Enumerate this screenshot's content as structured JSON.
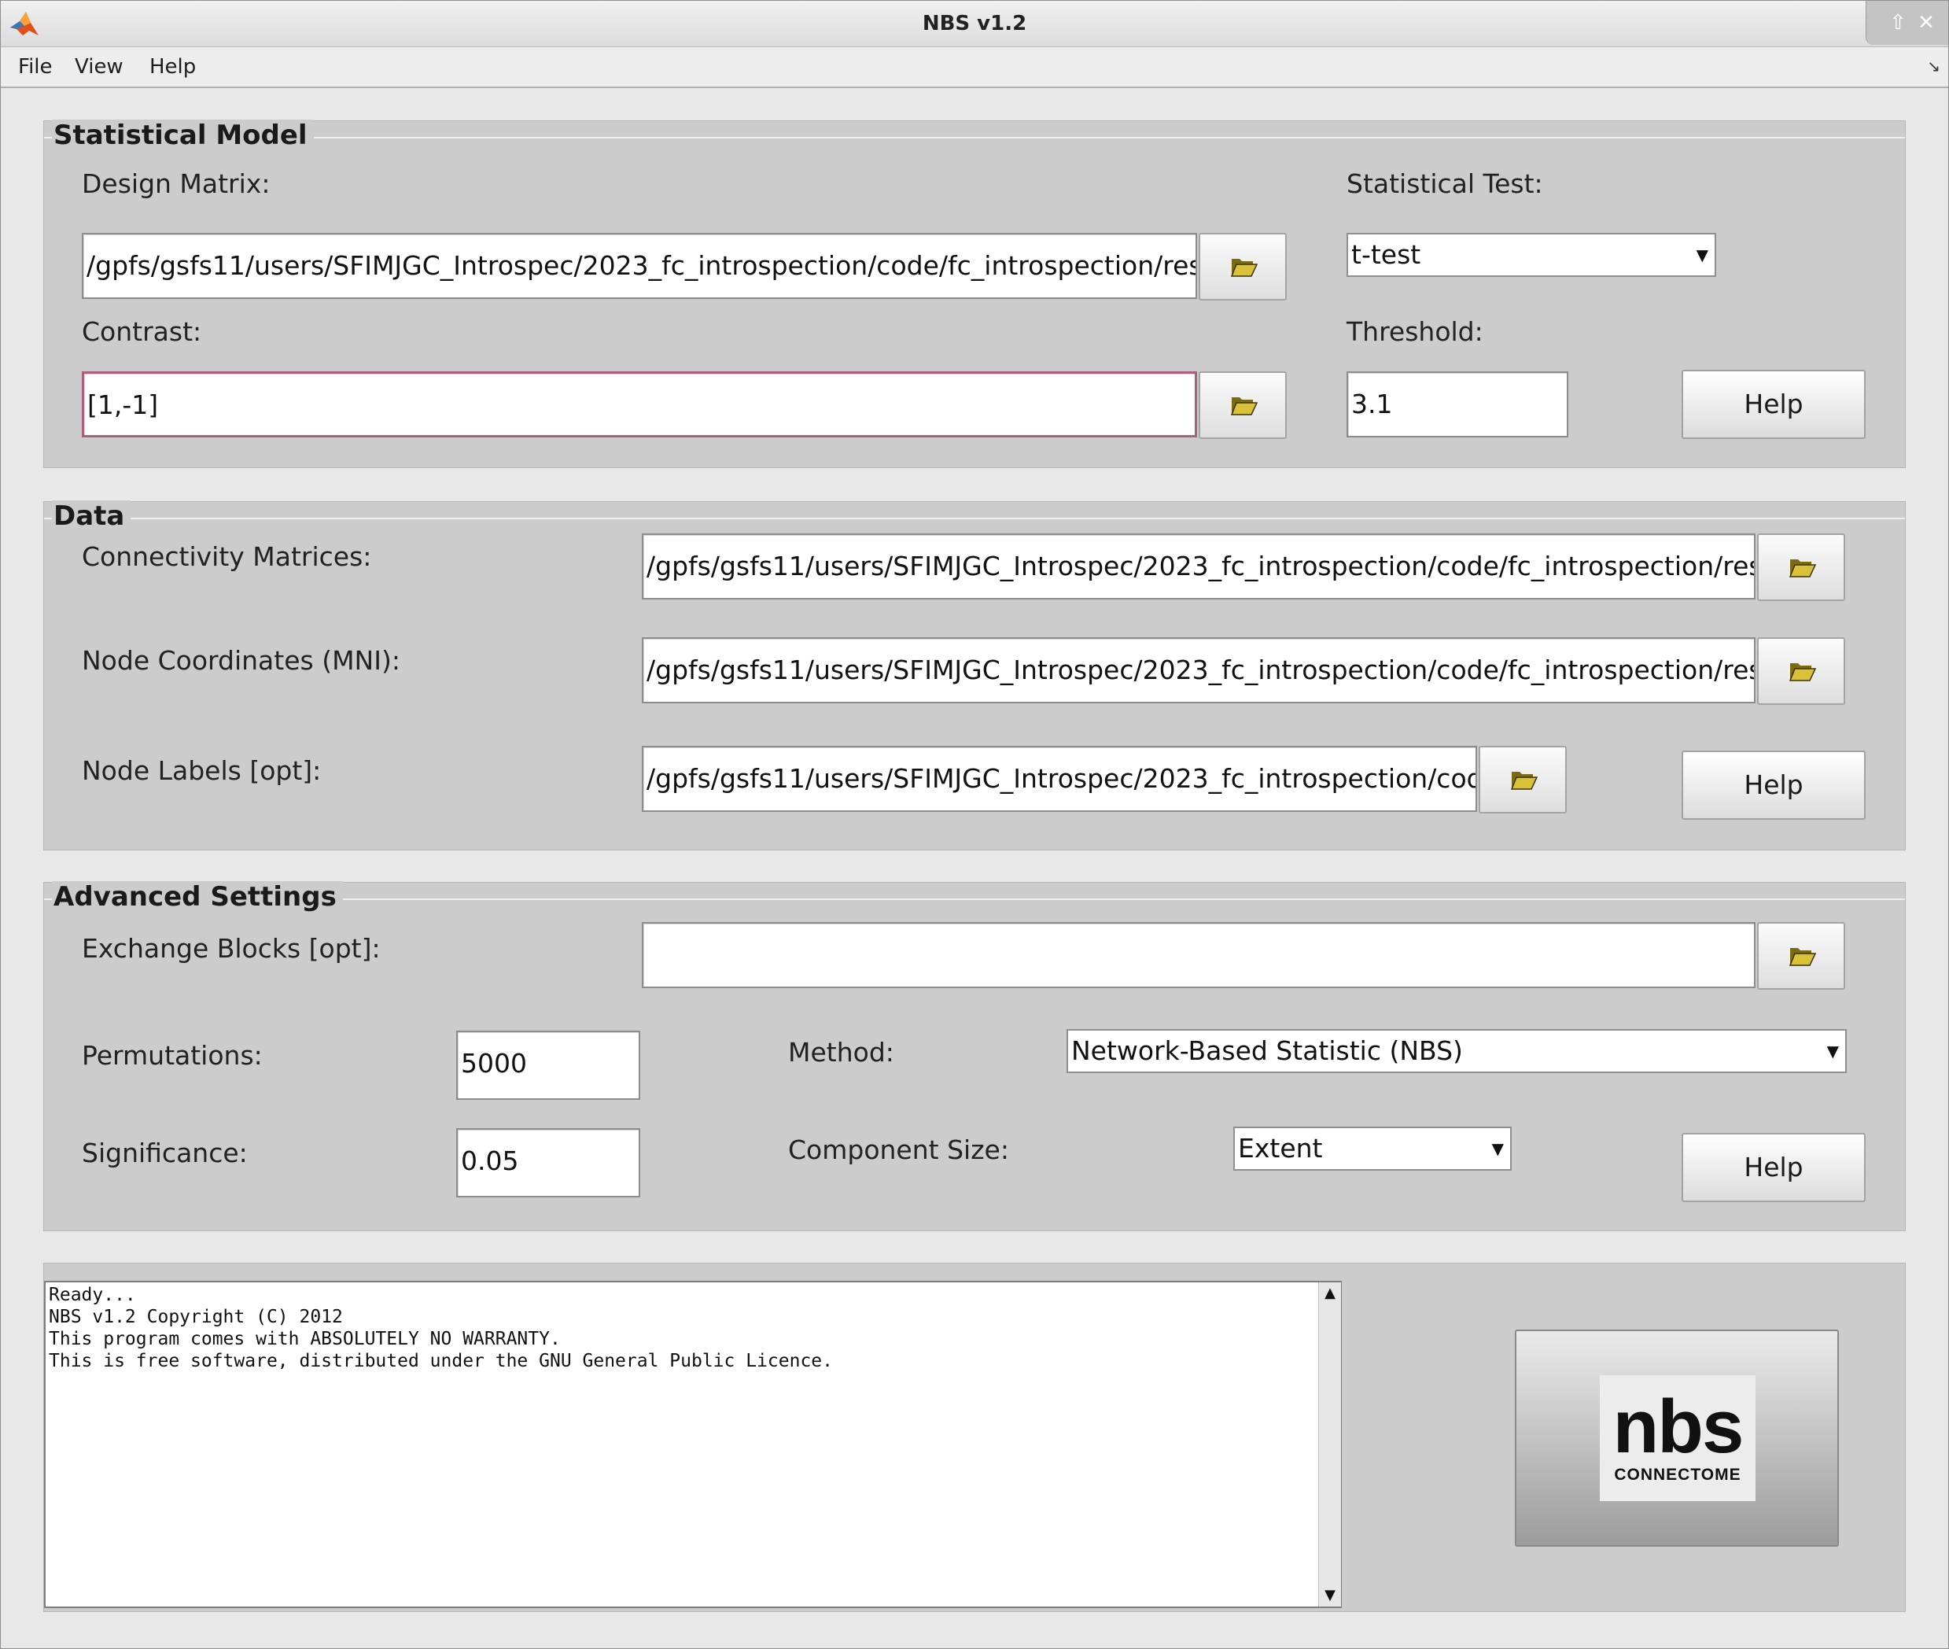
{
  "window": {
    "title": "NBS v1.2",
    "maximize_glyph": "⇧",
    "close_glyph": "✕"
  },
  "menu": {
    "file": "File",
    "view": "View",
    "help": "Help",
    "overflow_glyph": "↘"
  },
  "statistical_model": {
    "title": "Statistical Model",
    "design_matrix_label": "Design Matrix:",
    "design_matrix_value": "/gpfs/gsfs11/users/SFIMJGC_Introspec/2023_fc_introspection/code/fc_introspection/resources",
    "statistical_test_label": "Statistical Test:",
    "statistical_test_value": "t-test",
    "contrast_label": "Contrast:",
    "contrast_value": "[1,-1]",
    "threshold_label": "Threshold:",
    "threshold_value": "3.1",
    "help_label": "Help"
  },
  "data_panel": {
    "title": "Data",
    "connectivity_label": "Connectivity Matrices:",
    "connectivity_value": "/gpfs/gsfs11/users/SFIMJGC_Introspec/2023_fc_introspection/code/fc_introspection/resources",
    "node_coords_label": "Node Coordinates (MNI):",
    "node_coords_value": "/gpfs/gsfs11/users/SFIMJGC_Introspec/2023_fc_introspection/code/fc_introspection/resources",
    "node_labels_label": "Node Labels [opt]:",
    "node_labels_value": "/gpfs/gsfs11/users/SFIMJGC_Introspec/2023_fc_introspection/code/fc_introspection/resources",
    "help_label": "Help"
  },
  "advanced": {
    "title": "Advanced Settings",
    "exchange_label": "Exchange Blocks [opt]:",
    "exchange_value": "",
    "permutations_label": "Permutations:",
    "permutations_value": "5000",
    "method_label": "Method:",
    "method_value": "Network-Based Statistic (NBS)",
    "significance_label": "Significance:",
    "significance_value": "0.05",
    "component_size_label": "Component Size:",
    "component_size_value": "Extent",
    "help_label": "Help"
  },
  "console": {
    "lines": [
      "Ready...",
      "NBS v1.2 Copyright (C) 2012",
      "This program comes with ABSOLUTELY NO WARRANTY.",
      "This is free software, distributed under the GNU General Public Licence."
    ],
    "scroll_up_glyph": "▲",
    "scroll_down_glyph": "▼"
  },
  "logo": {
    "text": "nbs",
    "subtext": "CONNECTOME"
  },
  "colors": {
    "panel_bg": "#cccccc",
    "focus_border": "#a8607c",
    "folder_icon": "#d9c23a"
  }
}
